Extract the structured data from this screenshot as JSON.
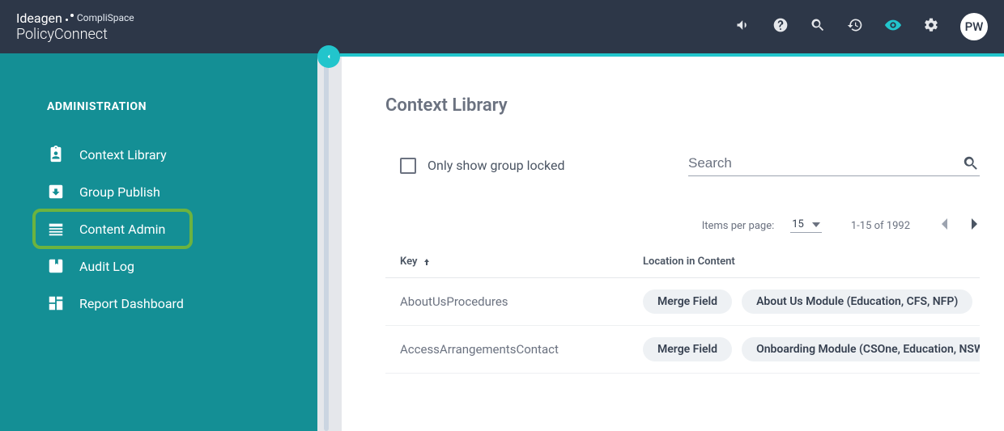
{
  "header": {
    "brand_line1a": "Ideagen",
    "brand_line1b": "CompliSpace",
    "brand_line2": "PolicyConnect",
    "avatar_initials": "PW"
  },
  "sidebar": {
    "heading": "ADMINISTRATION",
    "items": [
      {
        "label": "Context Library",
        "icon": "clipboard-user-icon"
      },
      {
        "label": "Group Publish",
        "icon": "download-box-icon"
      },
      {
        "label": "Content Admin",
        "icon": "list-box-icon"
      },
      {
        "label": "Audit Log",
        "icon": "bookmark-box-icon"
      },
      {
        "label": "Report Dashboard",
        "icon": "dashboard-icon"
      }
    ]
  },
  "main": {
    "title": "Context Library",
    "checkbox_label": "Only show group locked",
    "search_placeholder": "Search",
    "pagination": {
      "items_per_page_label": "Items per page:",
      "page_size": "15",
      "range": "1-15 of 1992"
    },
    "columns": {
      "key": "Key",
      "location": "Location in Content"
    },
    "rows": [
      {
        "key": "AboutUsProcedures",
        "chips": [
          "Merge Field",
          "About Us Module (Education, CFS, NFP)"
        ]
      },
      {
        "key": "AccessArrangementsContact",
        "chips": [
          "Merge Field",
          "Onboarding Module (CSOne, Education, NSW)"
        ]
      }
    ]
  }
}
